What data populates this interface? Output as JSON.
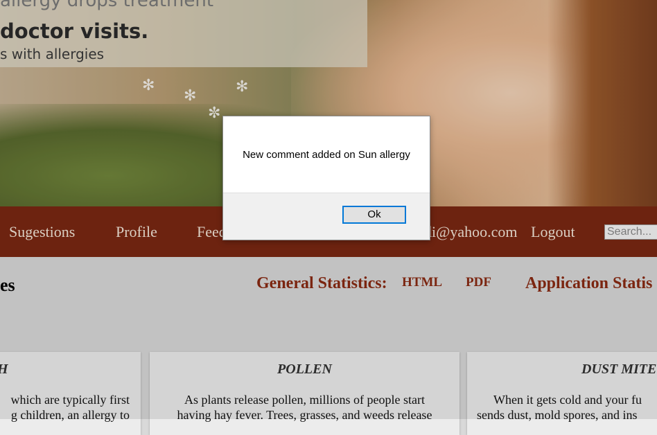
{
  "hero": {
    "tagline_top": "allergy drops treatment",
    "tagline_main": "doctor visits.",
    "tagline_sub": "s with allergies"
  },
  "nav": {
    "items": [
      "Sugestions",
      "Profile",
      "Feed",
      "di@yahoo.com",
      "Logout"
    ],
    "search_placeholder": "Search..."
  },
  "main": {
    "heading_partial": "es",
    "general_statistics_label": "General Statistics:",
    "html_link": "HTML",
    "pdf_link": "PDF",
    "application_statistics_label": "Application Statis"
  },
  "cards": [
    {
      "title": "H",
      "line1": "which are typically first",
      "line2": "g children, an allergy to"
    },
    {
      "title": "POLLEN",
      "line1": "As plants release pollen, millions of people start",
      "line2": "having hay fever. Trees, grasses, and weeds release"
    },
    {
      "title": "DUST MITE",
      "line1": "When it gets cold and your fu",
      "line2": "sends dust, mold spores, and ins"
    }
  ],
  "dialog": {
    "message": "New comment added on Sun allergy",
    "ok_label": "Ok"
  },
  "colors": {
    "nav_bg": "#7a2812",
    "accent_text": "#8a2a12",
    "dialog_button_border": "#0078d7"
  }
}
